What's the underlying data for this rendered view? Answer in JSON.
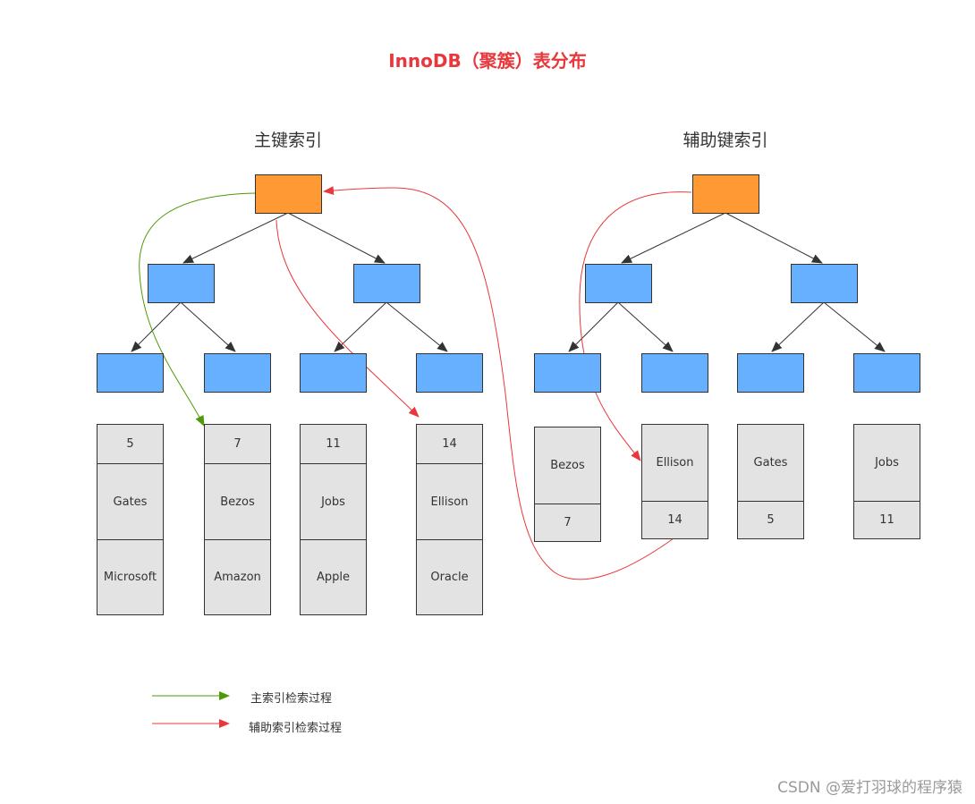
{
  "title": "InnoDB（聚簇）表分布",
  "primary_index": {
    "heading": "主键索引",
    "leaves": [
      {
        "cells": [
          "5",
          "Gates",
          "Microsoft"
        ]
      },
      {
        "cells": [
          "7",
          "Bezos",
          "Amazon"
        ]
      },
      {
        "cells": [
          "11",
          "Jobs",
          "Apple"
        ]
      },
      {
        "cells": [
          "14",
          "Ellison",
          "Oracle"
        ]
      }
    ]
  },
  "secondary_index": {
    "heading": "辅助键索引",
    "leaves": [
      {
        "cells": [
          "Bezos",
          "7"
        ]
      },
      {
        "cells": [
          "Ellison",
          "14"
        ]
      },
      {
        "cells": [
          "Gates",
          "5"
        ]
      },
      {
        "cells": [
          "Jobs",
          "11"
        ]
      }
    ]
  },
  "legend": [
    {
      "label": "主索引检索过程",
      "color": "#4e9a06"
    },
    {
      "label": "辅助索引检索过程",
      "color": "#e8383d"
    }
  ],
  "colors": {
    "root_node": "#ff9933",
    "inner_node": "#66b0ff",
    "leaf_node": "#e3e3e3",
    "primary_path": "#4e9a06",
    "secondary_path": "#e8383d"
  },
  "watermark": "CSDN @爱打羽球的程序猿"
}
